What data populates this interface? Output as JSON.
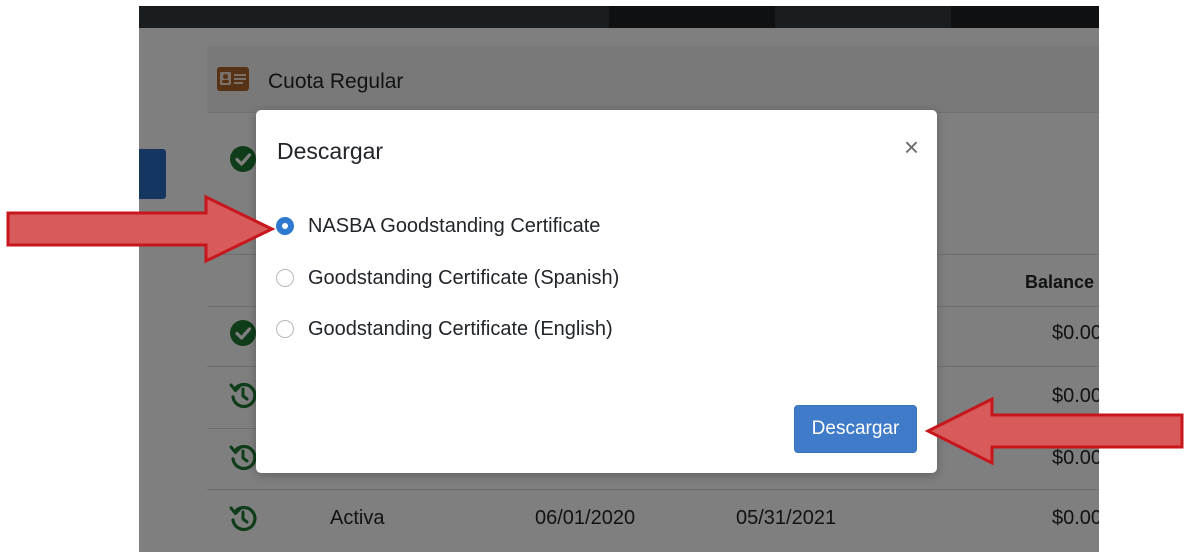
{
  "colors": {
    "overlay": "rgba(0,0,0,0.5)",
    "primary": "#3f7bc9",
    "success_icon": "#1f7a35",
    "arrow_fill": "#d85a5a",
    "arrow_stroke": "#c8161d",
    "header_icon": "#b0652a"
  },
  "background": {
    "card": {
      "icon": "id-card-icon",
      "title": "Cuota Regular"
    },
    "table": {
      "headers": {
        "balance": "Balance"
      },
      "rows": [
        {
          "status_icon": "check-circle-icon",
          "estado": "",
          "desde": "",
          "hasta": "",
          "balance": "$0.00"
        },
        {
          "status_icon": "history-icon",
          "estado": "",
          "desde": "",
          "hasta": "",
          "balance": "$0.00"
        },
        {
          "status_icon": "history-icon",
          "estado": "",
          "desde": "",
          "hasta": "",
          "balance": "$0.00"
        },
        {
          "status_icon": "history-icon",
          "estado": "Activa",
          "desde": "06/01/2020",
          "hasta": "05/31/2021",
          "balance": "$0.00"
        }
      ]
    }
  },
  "modal": {
    "title": "Descargar",
    "close_symbol": "×",
    "options": [
      {
        "label": "NASBA Goodstanding Certificate",
        "checked": true
      },
      {
        "label": "Goodstanding Certificate (Spanish)",
        "checked": false
      },
      {
        "label": "Goodstanding Certificate (English)",
        "checked": false
      }
    ],
    "submit_label": "Descargar"
  },
  "annotations": [
    {
      "icon": "arrow-right-icon",
      "points_to": "first option"
    },
    {
      "icon": "arrow-left-icon",
      "points_to": "download button"
    }
  ]
}
